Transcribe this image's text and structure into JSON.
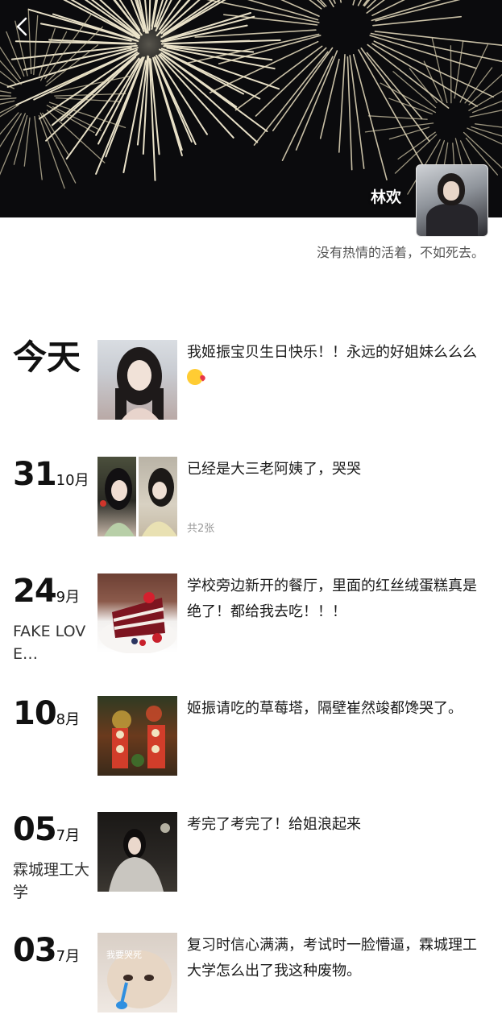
{
  "profile": {
    "nickname": "林欢",
    "signature": "没有热情的活着，不如死去。"
  },
  "icons": {
    "back": "chevron-left-icon"
  },
  "posts": [
    {
      "day": "今天",
      "month": "",
      "location": "",
      "text": "我姬振宝贝生日快乐！！永远的好姐妹么么么",
      "emoji": "kissing-face-icon",
      "photo_count": ""
    },
    {
      "day": "31",
      "month": "10月",
      "location": "",
      "text": "已经是大三老阿姨了，哭哭",
      "photo_count": "共2张"
    },
    {
      "day": "24",
      "month": "9月",
      "location": "FAKE LOVE…",
      "text": "学校旁边新开的餐厅，里面的红丝绒蛋糕真是绝了！都给我去吃！！！",
      "photo_count": ""
    },
    {
      "day": "10",
      "month": "8月",
      "location": "",
      "text": "姬振请吃的草莓塔，隔壁崔然竣都馋哭了。",
      "photo_count": ""
    },
    {
      "day": "05",
      "month": "7月",
      "location": "霖城理工大学",
      "text": "考完了考完了！给姐浪起来",
      "photo_count": ""
    },
    {
      "day": "03",
      "month": "7月",
      "location": "",
      "text": "复习时信心满满，考试时一脸懵逼，霖城理工大学怎么出了我这种废物。",
      "photo_count": "",
      "image_caption": "我要哭死"
    }
  ]
}
